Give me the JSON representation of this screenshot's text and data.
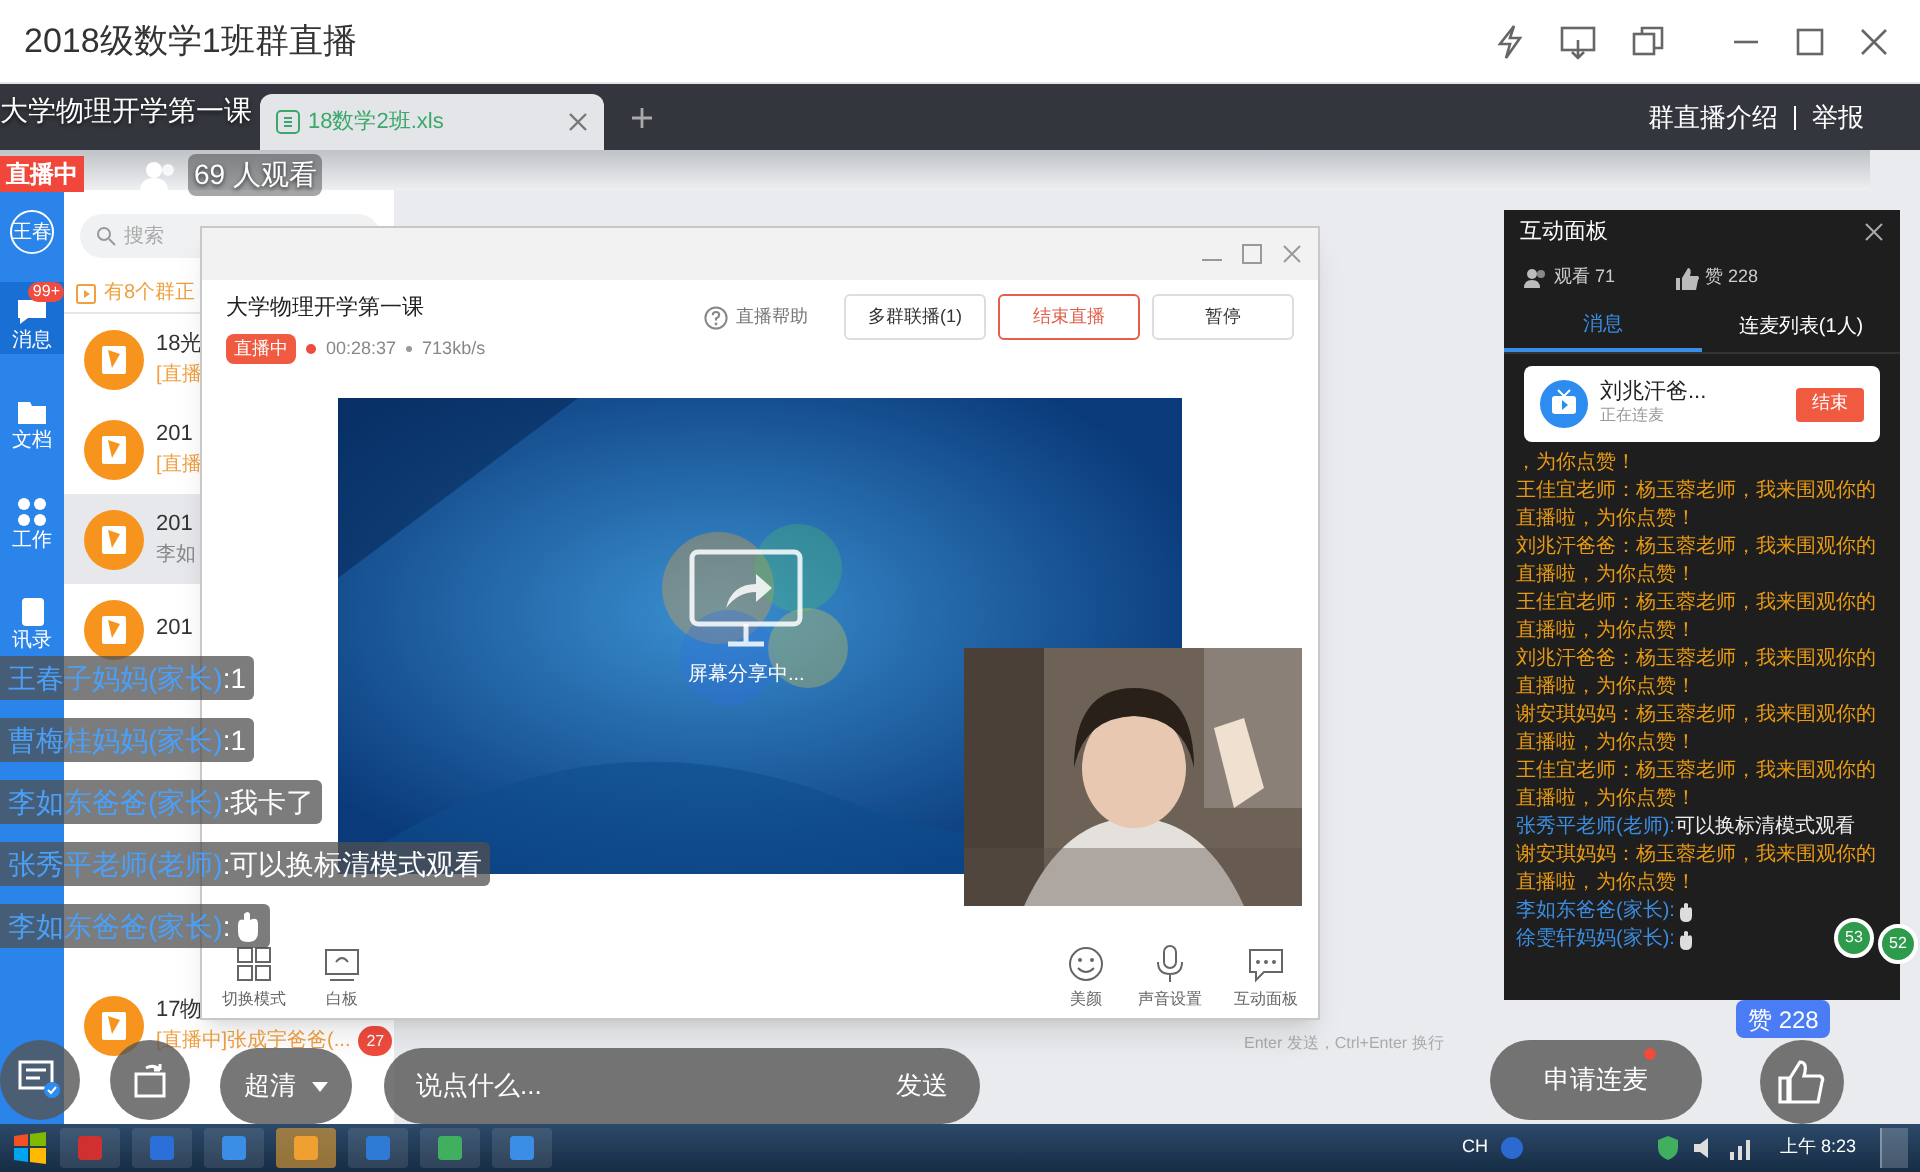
{
  "window": {
    "title": "2018级数学1班群直播"
  },
  "stream": {
    "title": "大学物理开学第一课",
    "live_badge": "直播中",
    "viewers": "69 人观看",
    "links": [
      "群直播介绍",
      "举报"
    ]
  },
  "desktop": {
    "browser_tabs": [
      {
        "label": "18数学2班.xls",
        "selected": true
      }
    ],
    "sidebar": {
      "avatar": "王春",
      "items": [
        {
          "label": "消息",
          "badge": "99+",
          "selected": true
        },
        {
          "label": "文档",
          "selected": false
        },
        {
          "label": "工作",
          "selected": false
        },
        {
          "label": "讯录",
          "selected": false
        }
      ]
    },
    "search": {
      "placeholder": "搜索"
    },
    "notice": "有8个群正",
    "chats": [
      {
        "title": "18光",
        "preview": "[直播",
        "selected": false
      },
      {
        "title": "201",
        "preview": "[直播",
        "selected": false
      },
      {
        "title": "201",
        "preview": "李如",
        "selected": true
      },
      {
        "title": "201",
        "selected": false
      },
      {
        "title": "17物",
        "preview": "[直播中]张成宇爸爸(...",
        "badge": "27",
        "selected": false
      }
    ],
    "input_hint": "Enter 发送，Ctrl+Enter 换行"
  },
  "live_window": {
    "title": "大学物理开学第一课",
    "badge": "直播中",
    "duration": "00:28:37",
    "bitrate": "713kb/s",
    "help": "直播帮助",
    "buttons": [
      {
        "label": "多群联播(1)",
        "kind": "plain"
      },
      {
        "label": "结束直播",
        "kind": "danger"
      },
      {
        "label": "暂停",
        "kind": "plain"
      }
    ],
    "share_status": "屏幕分享中...",
    "tools_left": [
      "切换模式",
      "白板"
    ],
    "tools_right": [
      "美颜",
      "声音设置",
      "互动面板"
    ]
  },
  "panel": {
    "title": "互动面板",
    "viewers": "观看 71",
    "likes": "赞 228",
    "tabs": [
      {
        "label": "消息",
        "selected": true
      },
      {
        "label": "连麦列表(1人)",
        "selected": false
      }
    ],
    "mic_card": {
      "name": "刘兆汗爸...",
      "status": "正在连麦",
      "button": "结束"
    },
    "messages": [
      {
        "kind": "cont",
        "text": "，为你点赞！"
      },
      {
        "kind": "greet",
        "name": "王佳宜老师：",
        "text": "杨玉蓉老师，我来围观你的直播啦，为你点赞！"
      },
      {
        "kind": "greet",
        "name": "刘兆汗爸爸：",
        "text": "杨玉蓉老师，我来围观你的直播啦，为你点赞！"
      },
      {
        "kind": "greet",
        "name": "王佳宜老师：",
        "text": "杨玉蓉老师，我来围观你的直播啦，为你点赞！"
      },
      {
        "kind": "greet",
        "name": "刘兆汗爸爸：",
        "text": "杨玉蓉老师，我来围观你的直播啦，为你点赞！"
      },
      {
        "kind": "greet",
        "name": "谢安琪妈妈：",
        "text": "杨玉蓉老师，我来围观你的直播啦，为你点赞！"
      },
      {
        "kind": "greet",
        "name": "王佳宜老师：",
        "text": "杨玉蓉老师，我来围观你的直播啦，为你点赞！"
      },
      {
        "kind": "chat",
        "name": "张秀平老师(老师):",
        "text": "可以换标清模式观看"
      },
      {
        "kind": "greet",
        "name": "谢安琪妈妈：",
        "text": "杨玉蓉老师，我来围观你的直播啦，为你点赞！"
      },
      {
        "kind": "sticker",
        "name": "李如东爸爸(家长):"
      },
      {
        "kind": "sticker",
        "name": "徐雯轩妈妈(家长):"
      }
    ],
    "side_counts": [
      "53",
      "52"
    ]
  },
  "bullet_chat": [
    {
      "kind": "text",
      "name": "王春子妈妈(家长)",
      "text": ":1"
    },
    {
      "kind": "text",
      "name": "曹梅桂妈妈(家长)",
      "text": ":1"
    },
    {
      "kind": "text",
      "name": "李如东爸爸(家长)",
      "text": ":我卡了"
    },
    {
      "kind": "text",
      "name": "张秀平老师(老师)",
      "text": ":可以换标清模式观看"
    },
    {
      "kind": "sticker",
      "name": "李如东爸爸(家长)",
      "text": ":"
    }
  ],
  "controls": {
    "quality": "超清",
    "input": {
      "placeholder": "说点什么..."
    },
    "send": "发送",
    "mic_request": "申请连麦",
    "likes": "赞 228"
  },
  "taskbar": {
    "language": "CH",
    "clock": "上午 8:23"
  }
}
